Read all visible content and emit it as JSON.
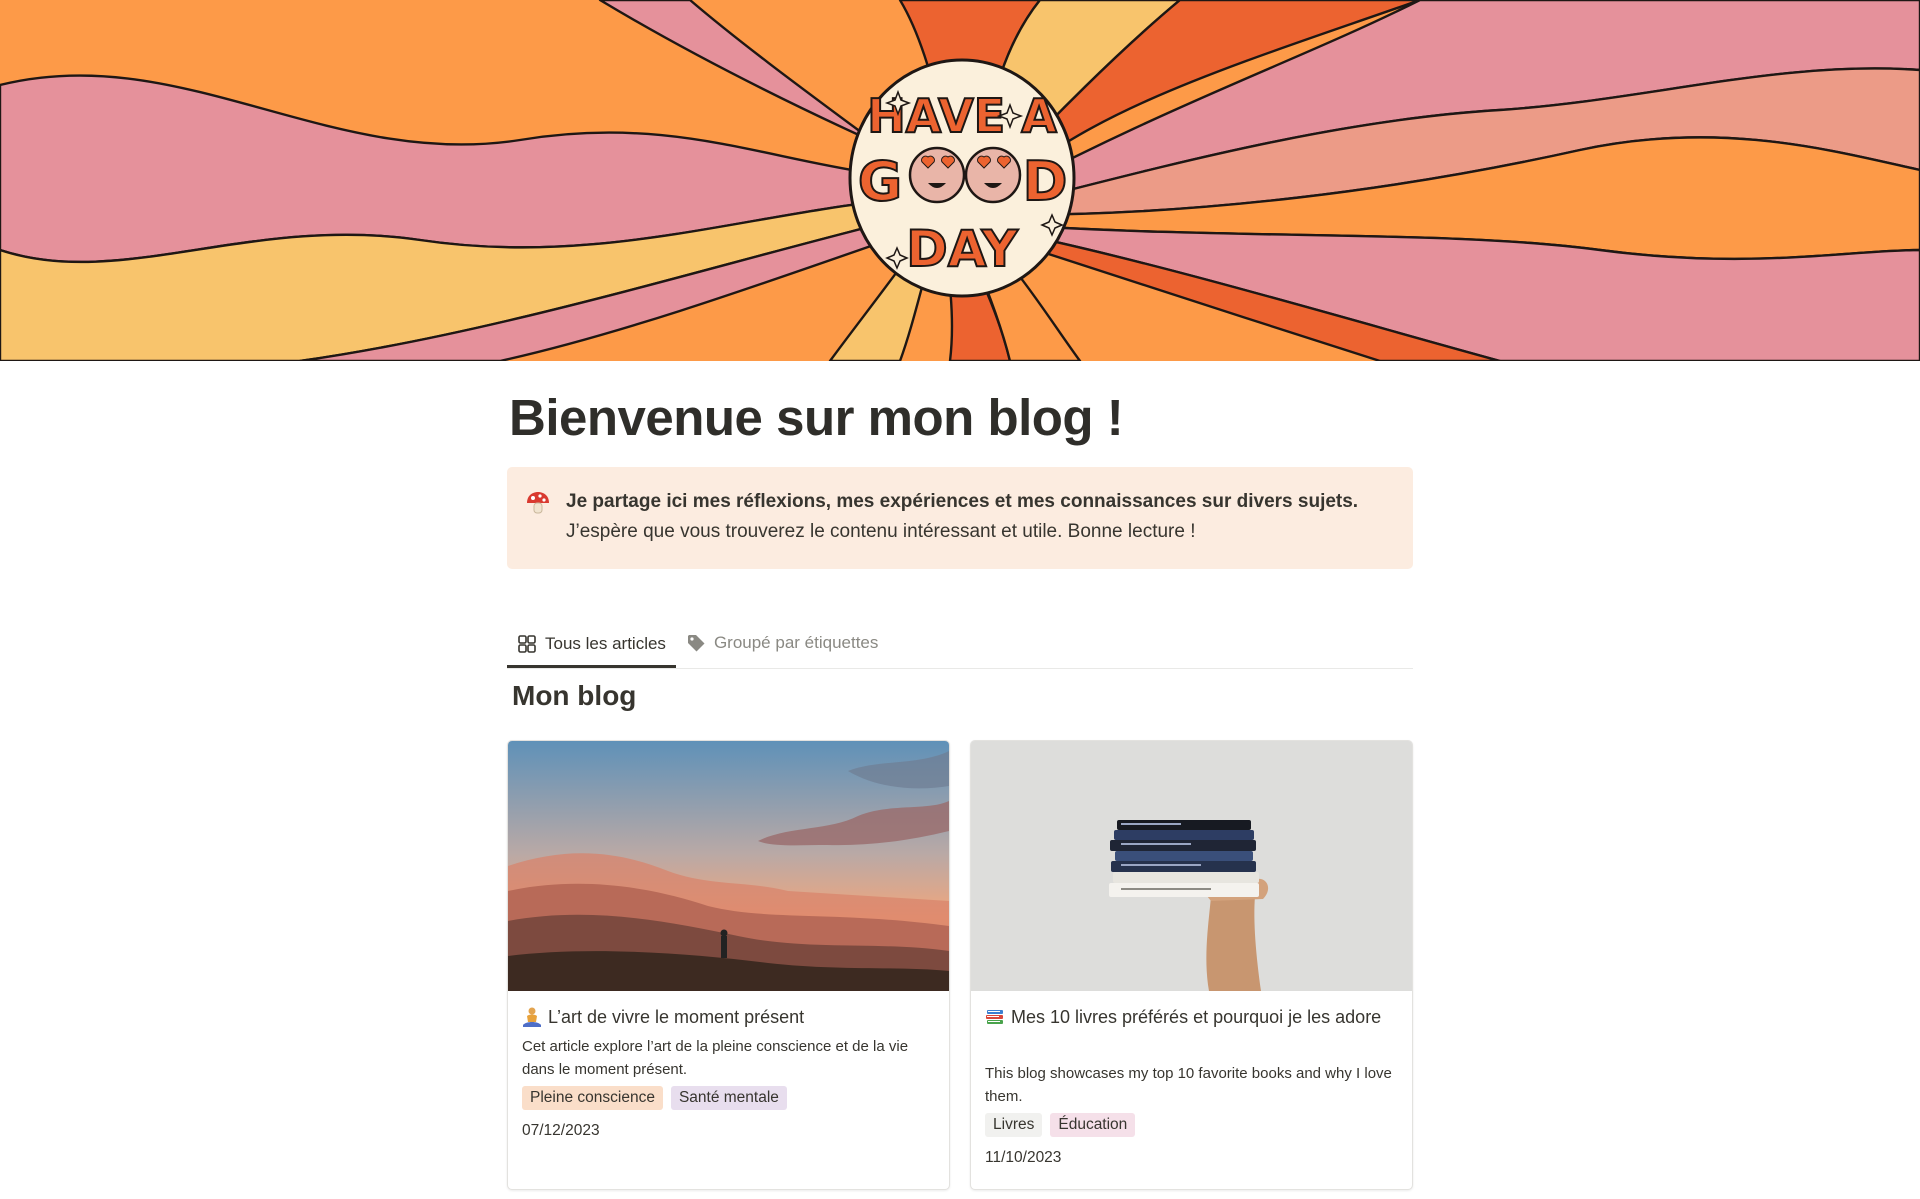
{
  "cover": {
    "logo_text_line1": "HAVE A",
    "logo_text_line2": "GOOD",
    "logo_text_line3": "DAY",
    "colors": {
      "orange": "#fd9a48",
      "pink": "#e5919b",
      "yellow": "#f8c46c",
      "deep_orange": "#ec6330",
      "salmon": "#ec9b87"
    }
  },
  "page": {
    "title": "Bienvenue sur mon blog !"
  },
  "callout": {
    "icon": "mushroom-icon",
    "bold_text": "Je partage ici mes réflexions, mes expériences et mes connaissances sur divers sujets.",
    "text": " J’espère que vous trouverez le contenu intéressant et utile. Bonne lecture !",
    "background": "#fcece0"
  },
  "tabs": [
    {
      "label": "Tous les articles",
      "icon": "gallery-grid-icon",
      "active": true
    },
    {
      "label": "Groupé par étiquettes",
      "icon": "tag-icon",
      "active": false
    }
  ],
  "database": {
    "title": "Mon blog",
    "cards": [
      {
        "emoji": "meditation-icon",
        "title": "L’art de vivre le moment présent",
        "description": "Cet article explore l’art de la pleine conscience et de la vie dans le moment présent.",
        "tags": [
          {
            "label": "Pleine conscience",
            "color": "#fadec9"
          },
          {
            "label": "Santé mentale",
            "color": "#e8deee"
          }
        ],
        "date": "07/12/2023",
        "cover": "mountain-sunset-image"
      },
      {
        "emoji": "books-icon",
        "title": "Mes 10 livres préférés et pourquoi je les adore",
        "description": "This blog showcases my top 10 favorite books and why I love them.",
        "tags": [
          {
            "label": "Livres",
            "color": "#f1f1ef"
          },
          {
            "label": "Éducation",
            "color": "#f5e0e9"
          }
        ],
        "date": "11/10/2023",
        "cover": "hand-holding-books-image"
      }
    ]
  }
}
